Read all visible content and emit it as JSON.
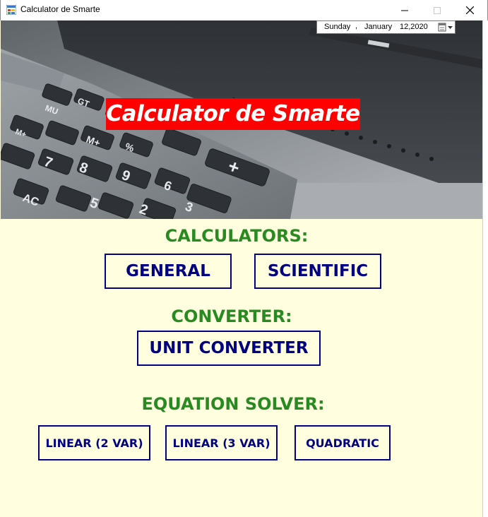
{
  "window": {
    "title": "Calculator de Smarte",
    "minimize_icon": "minimize-icon",
    "maximize_icon": "maximize-icon",
    "close_icon": "close-icon"
  },
  "date_picker": {
    "day": "Sunday",
    "comma": ",",
    "month": "January",
    "date_year": "12,2020",
    "button_icon": "calendar-dropdown-icon"
  },
  "banner": {
    "title": "Calculator de Smarte",
    "image": "calculator-photo"
  },
  "sections": {
    "calculators": {
      "heading": "CALCULATORS:",
      "buttons": [
        "GENERAL",
        "SCIENTIFIC"
      ]
    },
    "converter": {
      "heading": "CONVERTER:",
      "buttons": [
        "UNIT CONVERTER"
      ]
    },
    "equation_solver": {
      "heading": "EQUATION SOLVER:",
      "buttons": [
        "LINEAR (2 VAR)",
        "LINEAR (3 VAR)",
        "QUADRATIC"
      ]
    }
  },
  "colors": {
    "background": "#ffffe0",
    "heading": "#2a8a22",
    "button": "#000080",
    "banner_title_bg": "#ff0000"
  }
}
